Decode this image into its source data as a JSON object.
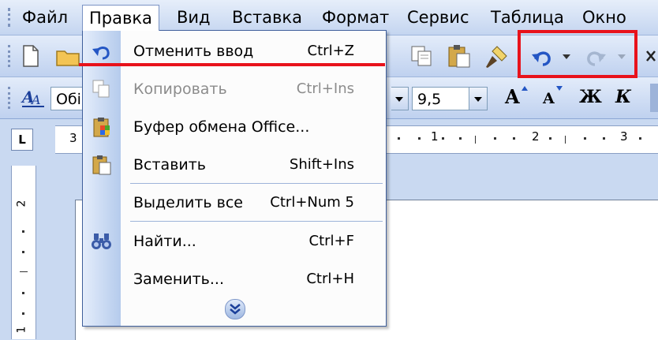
{
  "menubar": {
    "items": [
      {
        "label": "Файл"
      },
      {
        "label": "Правка"
      },
      {
        "label": "Вид"
      },
      {
        "label": "Вставка"
      },
      {
        "label": "Формат"
      },
      {
        "label": "Сервис"
      },
      {
        "label": "Таблица"
      },
      {
        "label": "Окно"
      }
    ]
  },
  "formatting": {
    "style_value": "Обі",
    "font_size_value": "9,5",
    "grow_font": "A",
    "shrink_font": "A",
    "bold": "Ж",
    "italic": "К"
  },
  "ruler": {
    "tab_selector": "L",
    "h_numbers": [
      "3",
      "1",
      "1",
      "2",
      "3"
    ],
    "v_numbers": [
      "2",
      "1"
    ]
  },
  "edit_menu": {
    "items": [
      {
        "label": "Отменить ввод",
        "shortcut": "Ctrl+Z",
        "icon": "undo-icon",
        "enabled": true
      },
      {
        "label": "Копировать",
        "shortcut": "Ctrl+Ins",
        "icon": "copy-icon",
        "enabled": false
      },
      {
        "label": "Буфер обмена Office...",
        "shortcut": "",
        "icon": "clipboard-office-icon",
        "enabled": true
      },
      {
        "label": "Вставить",
        "shortcut": "Shift+Ins",
        "icon": "paste-icon",
        "enabled": true
      },
      {
        "label": "Выделить все",
        "shortcut": "Ctrl+Num 5",
        "icon": "",
        "enabled": true
      },
      {
        "label": "Найти...",
        "shortcut": "Ctrl+F",
        "icon": "binoculars-icon",
        "enabled": true
      },
      {
        "label": "Заменить...",
        "shortcut": "Ctrl+H",
        "icon": "",
        "enabled": true
      }
    ],
    "expand_icon": "double-chevron-down-icon"
  },
  "colors": {
    "highlight_red": "#e8121b",
    "toolbar_blue": "#c4d5f0",
    "menu_border": "#3f5f9b"
  }
}
